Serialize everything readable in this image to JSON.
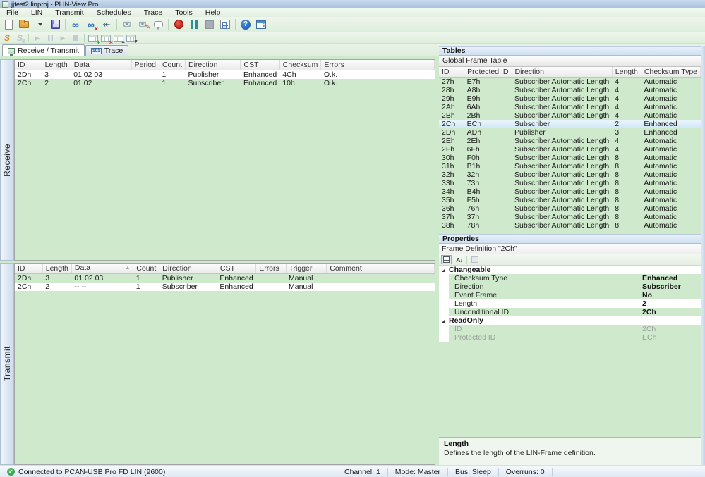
{
  "window": {
    "title": "jjtest2.linproj - PLIN-View Pro"
  },
  "menu": {
    "items": [
      {
        "key": "menu-file",
        "label": "File"
      },
      {
        "key": "menu-lin",
        "label": "LIN"
      },
      {
        "key": "menu-transmit",
        "label": "Transmit"
      },
      {
        "key": "menu-schedules",
        "label": "Schedules"
      },
      {
        "key": "menu-trace",
        "label": "Trace"
      },
      {
        "key": "menu-tools",
        "label": "Tools"
      },
      {
        "key": "menu-help",
        "label": "Help"
      }
    ]
  },
  "icons": {
    "toolbar_main": [
      "new-file",
      "open-project",
      "save-project",
      "connect",
      "disconnect",
      "hardware-reset",
      "new-message",
      "edit-message",
      "comment",
      "record",
      "pause",
      "stop",
      "checklist",
      "help",
      "status-info"
    ],
    "toolbar_schedule": [
      "schedule-run",
      "schedule-suspend",
      "schedule-play",
      "schedule-pause",
      "schedule-next",
      "schedule-stop",
      "table-add",
      "table-delete",
      "table-move-up",
      "table-move-down"
    ],
    "connect": "∞",
    "disconnect": "∞",
    "disconnect_badge": "×",
    "reset": "↞",
    "envelope": "✉",
    "pen": "✎",
    "help": "?",
    "info": "i",
    "schedule": "S",
    "schedule_badge": "⊗",
    "play": "▶",
    "next": "▶",
    "table_add": "+",
    "table_delete": "×",
    "table_up": "▲",
    "table_down": "▼",
    "sort_alpha": "A↓",
    "check": "✓",
    "trace_badge": "101",
    "sort_asc": "▲"
  },
  "tabs": {
    "receive_transmit": "Receive / Transmit",
    "trace": "Trace"
  },
  "receive": {
    "label": "Receive",
    "columns": [
      "ID",
      "Length",
      "Data",
      "Period",
      "Count",
      "Direction",
      "CST",
      "Checksum",
      "Errors"
    ],
    "rows": [
      {
        "id": "2Dh",
        "length": "3",
        "data": "01 02 03",
        "period": "",
        "count": "1",
        "direction": "Publisher",
        "cst": "Enhanced",
        "checksum": "4Ch",
        "errors": "O.k.",
        "state": "white"
      },
      {
        "id": "2Ch",
        "length": "2",
        "data": "01 02",
        "period": "",
        "count": "1",
        "direction": "Subscriber",
        "cst": "Enhanced",
        "checksum": "10h",
        "errors": "O.k.",
        "state": "green"
      }
    ]
  },
  "transmit": {
    "label": "Transmit",
    "columns": [
      "ID",
      "Length",
      "Data",
      "Count",
      "Direction",
      "CST",
      "Errors",
      "Trigger",
      "Comment"
    ],
    "rows": [
      {
        "id": "2Dh",
        "length": "3",
        "data": "01 02 03",
        "count": "1",
        "direction": "Publisher",
        "cst": "Enhanced",
        "errors": "",
        "trigger": "Manual",
        "comment": "",
        "state": "green"
      },
      {
        "id": "2Ch",
        "length": "2",
        "data": "-- --",
        "count": "1",
        "direction": "Subscriber",
        "cst": "Enhanced",
        "errors": "",
        "trigger": "Manual",
        "comment": "",
        "state": "white"
      }
    ]
  },
  "tables_panel": {
    "title": "Tables",
    "subtitle": "Global Frame Table",
    "columns": [
      "ID",
      "Protected ID",
      "Direction",
      "Length",
      "Checksum Type"
    ],
    "rows": [
      {
        "id": "27h",
        "pid": "E7h",
        "direction": "Subscriber Automatic Length",
        "length": "4",
        "checksum": "Automatic",
        "state": "green"
      },
      {
        "id": "28h",
        "pid": "A8h",
        "direction": "Subscriber Automatic Length",
        "length": "4",
        "checksum": "Automatic",
        "state": "green"
      },
      {
        "id": "29h",
        "pid": "E9h",
        "direction": "Subscriber Automatic Length",
        "length": "4",
        "checksum": "Automatic",
        "state": "green"
      },
      {
        "id": "2Ah",
        "pid": "6Ah",
        "direction": "Subscriber Automatic Length",
        "length": "4",
        "checksum": "Automatic",
        "state": "green"
      },
      {
        "id": "2Bh",
        "pid": "2Bh",
        "direction": "Subscriber Automatic Length",
        "length": "4",
        "checksum": "Automatic",
        "state": "green"
      },
      {
        "id": "2Ch",
        "pid": "ECh",
        "direction": "Subscriber",
        "length": "2",
        "checksum": "Enhanced",
        "state": "selected"
      },
      {
        "id": "2Dh",
        "pid": "ADh",
        "direction": "Publisher",
        "length": "3",
        "checksum": "Enhanced",
        "state": "green"
      },
      {
        "id": "2Eh",
        "pid": "2Eh",
        "direction": "Subscriber Automatic Length",
        "length": "4",
        "checksum": "Automatic",
        "state": "green"
      },
      {
        "id": "2Fh",
        "pid": "6Fh",
        "direction": "Subscriber Automatic Length",
        "length": "4",
        "checksum": "Automatic",
        "state": "green"
      },
      {
        "id": "30h",
        "pid": "F0h",
        "direction": "Subscriber Automatic Length",
        "length": "8",
        "checksum": "Automatic",
        "state": "green"
      },
      {
        "id": "31h",
        "pid": "B1h",
        "direction": "Subscriber Automatic Length",
        "length": "8",
        "checksum": "Automatic",
        "state": "green"
      },
      {
        "id": "32h",
        "pid": "32h",
        "direction": "Subscriber Automatic Length",
        "length": "8",
        "checksum": "Automatic",
        "state": "green"
      },
      {
        "id": "33h",
        "pid": "73h",
        "direction": "Subscriber Automatic Length",
        "length": "8",
        "checksum": "Automatic",
        "state": "green"
      },
      {
        "id": "34h",
        "pid": "B4h",
        "direction": "Subscriber Automatic Length",
        "length": "8",
        "checksum": "Automatic",
        "state": "green"
      },
      {
        "id": "35h",
        "pid": "F5h",
        "direction": "Subscriber Automatic Length",
        "length": "8",
        "checksum": "Automatic",
        "state": "green"
      },
      {
        "id": "36h",
        "pid": "76h",
        "direction": "Subscriber Automatic Length",
        "length": "8",
        "checksum": "Automatic",
        "state": "green"
      },
      {
        "id": "37h",
        "pid": "37h",
        "direction": "Subscriber Automatic Length",
        "length": "8",
        "checksum": "Automatic",
        "state": "green"
      },
      {
        "id": "38h",
        "pid": "78h",
        "direction": "Subscriber Automatic Length",
        "length": "8",
        "checksum": "Automatic",
        "state": "green"
      }
    ]
  },
  "properties_panel": {
    "title": "Properties",
    "subtitle": "Frame Definition \"2Ch\"",
    "changeable": {
      "label": "Changeable",
      "rows": [
        {
          "name": "Checksum Type",
          "value": "Enhanced",
          "state": ""
        },
        {
          "name": "Direction",
          "value": "Subscriber",
          "state": ""
        },
        {
          "name": "Event Frame",
          "value": "No",
          "state": ""
        },
        {
          "name": "Length",
          "value": "2",
          "state": "selected"
        },
        {
          "name": "Unconditional ID",
          "value": "2Ch",
          "state": ""
        }
      ]
    },
    "readonly": {
      "label": "ReadOnly",
      "rows": [
        {
          "name": "ID",
          "value": "2Ch",
          "state": "readonly"
        },
        {
          "name": "Protected ID",
          "value": "ECh",
          "state": "readonly"
        }
      ]
    },
    "help": {
      "title": "Length",
      "text": "Defines the length of the LIN-Frame definition."
    }
  },
  "statusbar": {
    "connection": "Connected to PCAN-USB Pro FD LIN (9600)",
    "channel": "Channel: 1",
    "mode": "Mode: Master",
    "bus": "Bus: Sleep",
    "overruns": "Overruns: 0"
  }
}
